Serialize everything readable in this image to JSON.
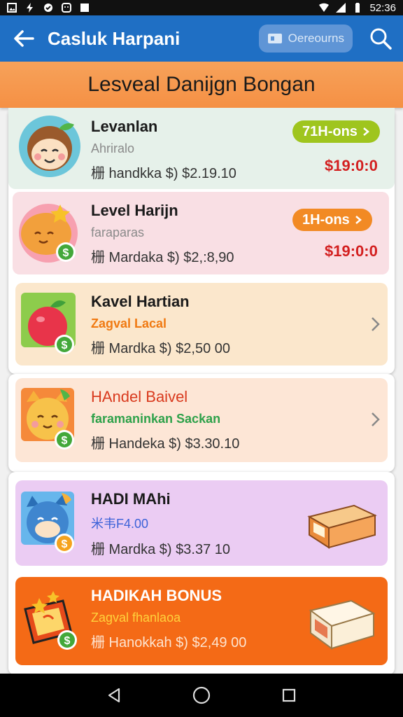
{
  "status_bar": {
    "time": "52:36"
  },
  "app_bar": {
    "title": "Casluk Harpani",
    "chip_label": "Oerеourns"
  },
  "banner": {
    "title": "Lesveal Danijgn Bongan"
  },
  "items": [
    {
      "title": "Levanlan",
      "subtitle": "Ahriralo",
      "subtitle_color": "#8a8a8a",
      "price_line": "栅 handkka $) $2.19.10",
      "badge": "71H-ons",
      "badge_color": "#9fc51e",
      "amount": "$19:0:0",
      "bg": "#e6f1ea"
    },
    {
      "title": "Level Harijn",
      "subtitle": "faraparas",
      "subtitle_color": "#8a8a8a",
      "price_line": "栅 Mardaka $) $2,:8,90",
      "badge": "1H-ons",
      "badge_color": "#f28a24",
      "amount": "$19:0:0",
      "bg": "#f9dfe4"
    },
    {
      "title": "Kavel Hartian",
      "subtitle": "Zagval Lacal",
      "subtitle_color": "#f07a12",
      "price_line": "栅 Mardka $) $2,50 00",
      "bg": "#fbe7cc"
    },
    {
      "title": "HAndel Baivel",
      "subtitle": "faramaninkan Sackan",
      "subtitle_color": "#2ea14a",
      "price_line": "栅 Handeka $) $3.30.10",
      "bg": "#fde6d6"
    },
    {
      "title": "HADI MAhi",
      "subtitle": "米韦F4.00",
      "subtitle_color": "#3c62d8",
      "price_line": "栅 Mardka $) $3.37 10",
      "bg": "#ebccf3"
    },
    {
      "title": "HADIKAH BONUS",
      "subtitle": "Zagval fhanlaoa",
      "subtitle_color": "#ffd23c",
      "price_line": "栅 Hanokkah $) $2,49 00",
      "bg": "#f46a16"
    }
  ],
  "icons": {
    "back": "arrow-left",
    "search": "magnifier",
    "chip": "ticket",
    "thumbs": [
      "monkey-face",
      "star-pie",
      "apple",
      "cat-face",
      "blue-cat",
      "bonus-tablet"
    ],
    "illustrations": [
      "bonus-box",
      "bonus-bag"
    ]
  }
}
